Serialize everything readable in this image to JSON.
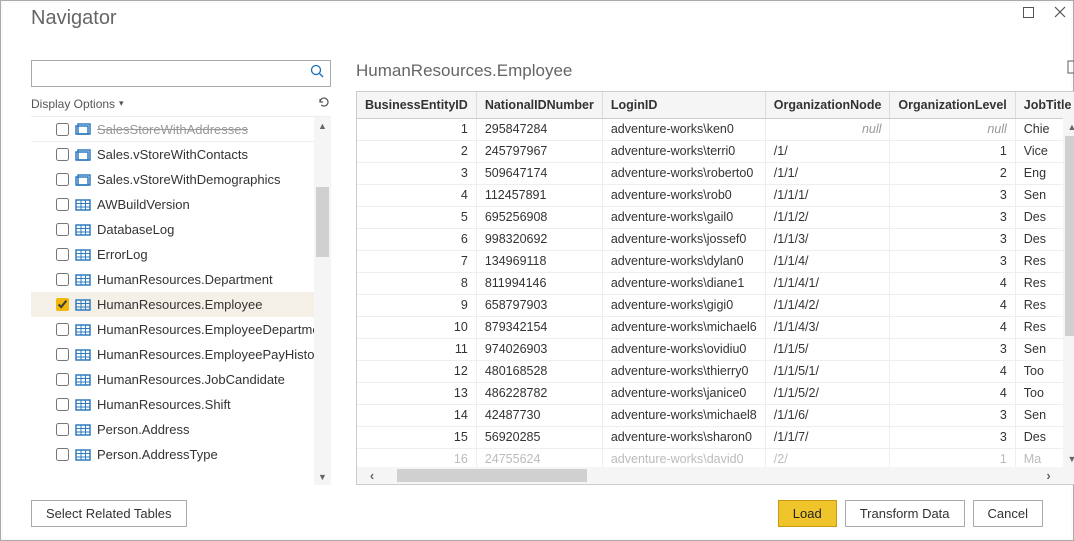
{
  "window": {
    "title": "Navigator"
  },
  "search": {
    "placeholder": ""
  },
  "display_options_label": "Display Options",
  "tree": {
    "cut_label": "SalesStoreWithAddresses",
    "items": [
      {
        "label": "Sales.vStoreWithContacts",
        "icon": "view",
        "checked": false
      },
      {
        "label": "Sales.vStoreWithDemographics",
        "icon": "view",
        "checked": false
      },
      {
        "label": "AWBuildVersion",
        "icon": "table",
        "checked": false
      },
      {
        "label": "DatabaseLog",
        "icon": "table",
        "checked": false
      },
      {
        "label": "ErrorLog",
        "icon": "table",
        "checked": false
      },
      {
        "label": "HumanResources.Department",
        "icon": "table",
        "checked": false
      },
      {
        "label": "HumanResources.Employee",
        "icon": "table",
        "checked": true
      },
      {
        "label": "HumanResources.EmployeeDepartmen...",
        "icon": "table",
        "checked": false
      },
      {
        "label": "HumanResources.EmployeePayHistory",
        "icon": "table",
        "checked": false
      },
      {
        "label": "HumanResources.JobCandidate",
        "icon": "table",
        "checked": false
      },
      {
        "label": "HumanResources.Shift",
        "icon": "table",
        "checked": false
      },
      {
        "label": "Person.Address",
        "icon": "table",
        "checked": false
      },
      {
        "label": "Person.AddressType",
        "icon": "table",
        "checked": false
      }
    ]
  },
  "preview": {
    "title": "HumanResources.Employee",
    "columns": [
      "BusinessEntityID",
      "NationalIDNumber",
      "LoginID",
      "OrganizationNode",
      "OrganizationLevel",
      "JobTitle"
    ],
    "rows": [
      {
        "id": "1",
        "nid": "295847284",
        "login": "adventure-works\\ken0",
        "node": "null",
        "level": "null",
        "job": "Chie",
        "null_node": true,
        "null_level": true
      },
      {
        "id": "2",
        "nid": "245797967",
        "login": "adventure-works\\terri0",
        "node": "/1/",
        "level": "1",
        "job": "Vice"
      },
      {
        "id": "3",
        "nid": "509647174",
        "login": "adventure-works\\roberto0",
        "node": "/1/1/",
        "level": "2",
        "job": "Eng"
      },
      {
        "id": "4",
        "nid": "112457891",
        "login": "adventure-works\\rob0",
        "node": "/1/1/1/",
        "level": "3",
        "job": "Sen"
      },
      {
        "id": "5",
        "nid": "695256908",
        "login": "adventure-works\\gail0",
        "node": "/1/1/2/",
        "level": "3",
        "job": "Des"
      },
      {
        "id": "6",
        "nid": "998320692",
        "login": "adventure-works\\jossef0",
        "node": "/1/1/3/",
        "level": "3",
        "job": "Des"
      },
      {
        "id": "7",
        "nid": "134969118",
        "login": "adventure-works\\dylan0",
        "node": "/1/1/4/",
        "level": "3",
        "job": "Res"
      },
      {
        "id": "8",
        "nid": "811994146",
        "login": "adventure-works\\diane1",
        "node": "/1/1/4/1/",
        "level": "4",
        "job": "Res"
      },
      {
        "id": "9",
        "nid": "658797903",
        "login": "adventure-works\\gigi0",
        "node": "/1/1/4/2/",
        "level": "4",
        "job": "Res"
      },
      {
        "id": "10",
        "nid": "879342154",
        "login": "adventure-works\\michael6",
        "node": "/1/1/4/3/",
        "level": "4",
        "job": "Res"
      },
      {
        "id": "11",
        "nid": "974026903",
        "login": "adventure-works\\ovidiu0",
        "node": "/1/1/5/",
        "level": "3",
        "job": "Sen"
      },
      {
        "id": "12",
        "nid": "480168528",
        "login": "adventure-works\\thierry0",
        "node": "/1/1/5/1/",
        "level": "4",
        "job": "Too"
      },
      {
        "id": "13",
        "nid": "486228782",
        "login": "adventure-works\\janice0",
        "node": "/1/1/5/2/",
        "level": "4",
        "job": "Too"
      },
      {
        "id": "14",
        "nid": "42487730",
        "login": "adventure-works\\michael8",
        "node": "/1/1/6/",
        "level": "3",
        "job": "Sen"
      },
      {
        "id": "15",
        "nid": "56920285",
        "login": "adventure-works\\sharon0",
        "node": "/1/1/7/",
        "level": "3",
        "job": "Des"
      }
    ],
    "faded_row": {
      "id": "16",
      "nid": "24755624",
      "login": "adventure-works\\david0",
      "node": "/2/",
      "level": "1",
      "job": "Ma"
    }
  },
  "footer": {
    "select_related": "Select Related Tables",
    "load": "Load",
    "transform": "Transform Data",
    "cancel": "Cancel"
  }
}
